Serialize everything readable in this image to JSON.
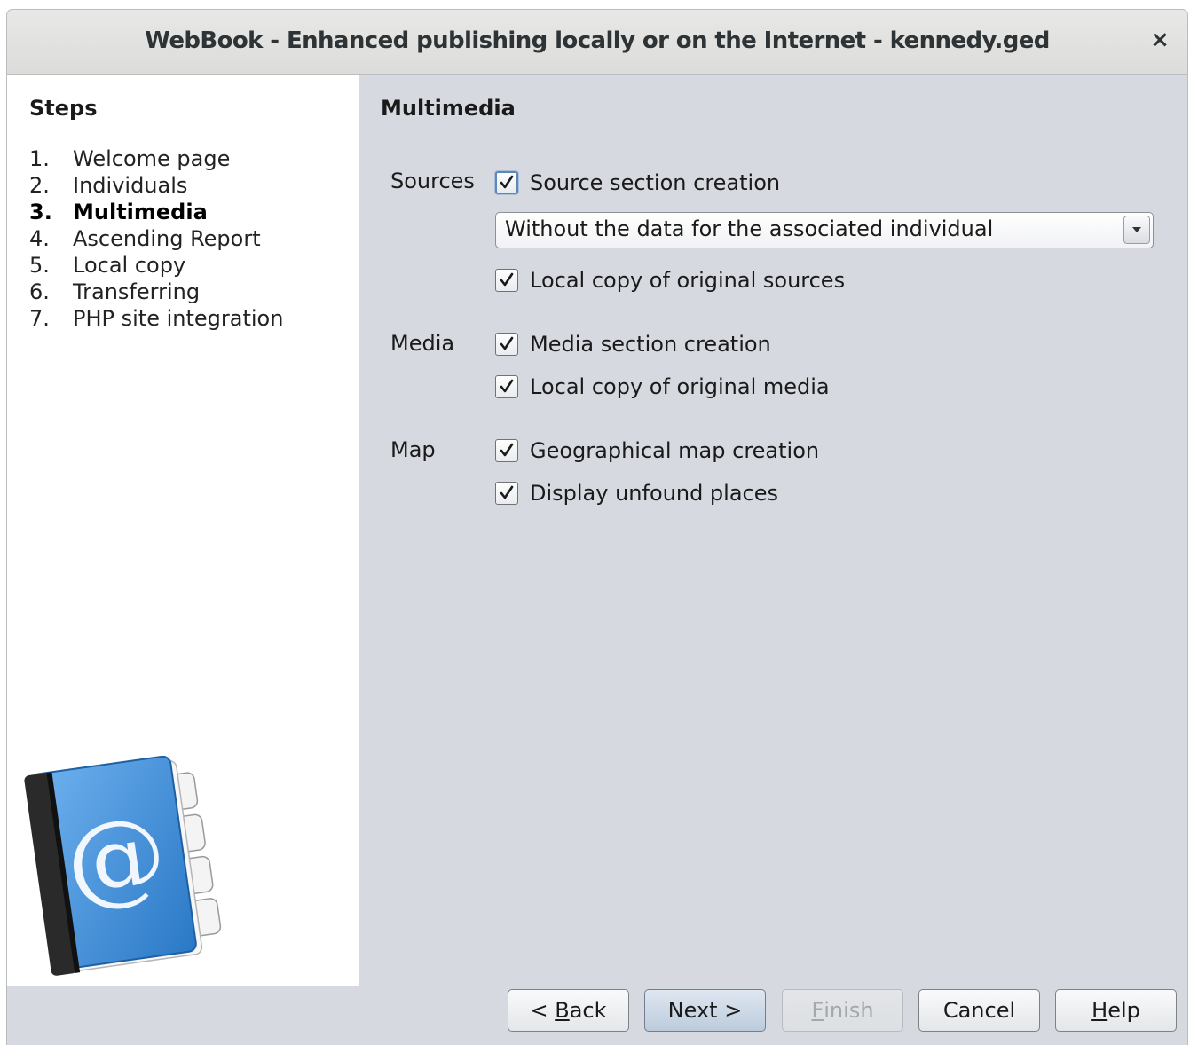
{
  "window": {
    "title": "WebBook - Enhanced publishing locally or on the Internet - kennedy.ged",
    "close_glyph": "×"
  },
  "steps": {
    "heading": "Steps",
    "current_index": 2,
    "items": [
      {
        "num": "1.",
        "label": "Welcome page"
      },
      {
        "num": "2.",
        "label": "Individuals"
      },
      {
        "num": "3.",
        "label": "Multimedia"
      },
      {
        "num": "4.",
        "label": "Ascending Report"
      },
      {
        "num": "5.",
        "label": "Local copy"
      },
      {
        "num": "6.",
        "label": "Transferring"
      },
      {
        "num": "7.",
        "label": "PHP site integration"
      }
    ],
    "icon": "address-book-icon"
  },
  "content": {
    "heading": "Multimedia",
    "sources": {
      "label": "Sources",
      "section_creation": {
        "label": "Source section creation",
        "checked": true
      },
      "combo_value": "Without the data for the associated individual",
      "local_copy": {
        "label": "Local copy of original sources",
        "checked": true
      }
    },
    "media": {
      "label": "Media",
      "section_creation": {
        "label": "Media section creation",
        "checked": true
      },
      "local_copy": {
        "label": "Local copy of original media",
        "checked": true
      }
    },
    "map": {
      "label": "Map",
      "map_creation": {
        "label": "Geographical map creation",
        "checked": true
      },
      "unfound_places": {
        "label": "Display unfound places",
        "checked": true
      }
    }
  },
  "buttons": {
    "back": {
      "pre": "< ",
      "mnemonic": "B",
      "post": "ack"
    },
    "next": {
      "label": "Next >"
    },
    "finish": {
      "pre": "",
      "mnemonic": "F",
      "post": "inish",
      "enabled": false
    },
    "cancel": {
      "label": "Cancel"
    },
    "help": {
      "pre": "",
      "mnemonic": "H",
      "post": "elp"
    }
  },
  "colors": {
    "window_bg": "#d6d9df",
    "side_panel_bg": "#ffffff",
    "book_blue": "#3d8fd8"
  }
}
